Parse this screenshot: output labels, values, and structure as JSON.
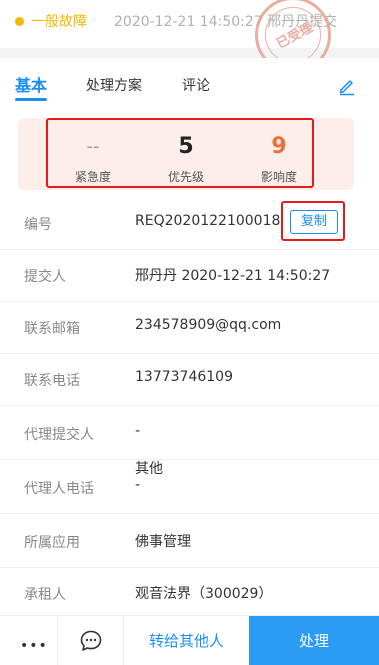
{
  "header": {
    "type_label": "一般故障",
    "meta": "2020-12-21 14:50:27  邢丹丹提交",
    "stamp_text": "已受理",
    "type_color": "#f5b800"
  },
  "tabs": [
    {
      "label": "基本",
      "active": true
    },
    {
      "label": "处理方案",
      "active": false
    },
    {
      "label": "评论",
      "active": false
    }
  ],
  "edit_icon": "pencil-icon",
  "stats": {
    "urgency": {
      "value": "--",
      "label": "紧急度"
    },
    "priority": {
      "value": "5",
      "label": "优先级"
    },
    "impact": {
      "value": "9",
      "label": "影响度"
    }
  },
  "fields": [
    {
      "label": "编号",
      "value": "REQ2020122100018"
    },
    {
      "label": "提交人",
      "value": "邢丹丹  2020-12-21 14:50:27"
    },
    {
      "label": "联系邮箱",
      "value": "234578909@qq.com"
    },
    {
      "label": "联系电话",
      "value": "13773746109"
    },
    {
      "label": "代理提交人",
      "value": "-"
    },
    {
      "label": "代理人电话",
      "value": "-",
      "extra": "其他"
    },
    {
      "label": "所属应用",
      "value": "佛事管理"
    },
    {
      "label": "承租人",
      "value": "观音法界（300029）"
    }
  ],
  "copy_button": "复制",
  "bottom_bar": {
    "more": "•••",
    "chat_icon": "chat-bubble-icon",
    "transfer": "转给其他人",
    "process": "处理"
  },
  "colors": {
    "accent": "#1a8ff0",
    "primary_button": "#2b9bf4",
    "impact": "#ec6f3b",
    "highlight_border": "#e41b1b",
    "stats_bg": "#fdeee9"
  }
}
